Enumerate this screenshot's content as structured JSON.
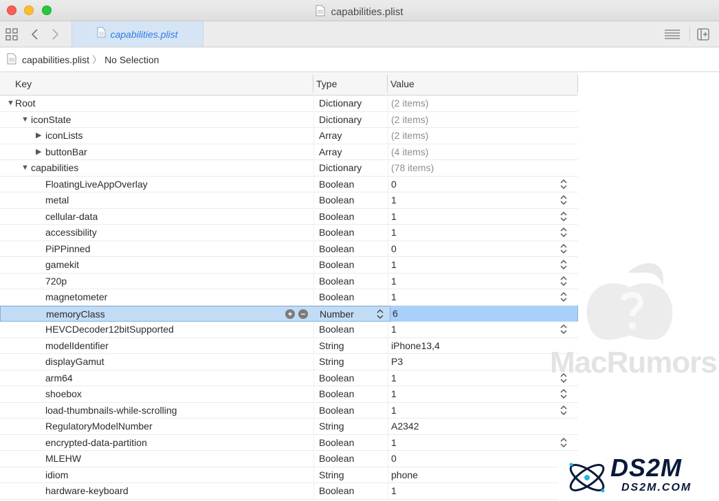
{
  "window": {
    "title": "capabilities.plist",
    "controls": [
      "close",
      "minimize",
      "zoom"
    ]
  },
  "toolbar": {
    "tab_label": "capabilities.plist",
    "icons": [
      "grid-icon",
      "back-chevron-icon",
      "forward-chevron-icon",
      "editor-options-icon",
      "add-editor-icon"
    ]
  },
  "jumpbar": {
    "file": "capabilities.plist",
    "selection": "No Selection"
  },
  "table": {
    "headers": {
      "key": "Key",
      "type": "Type",
      "value": "Value"
    },
    "rows": [
      {
        "key": "Root",
        "type": "Dictionary",
        "value": "(2 items)",
        "level": 0,
        "disclosure": "open",
        "muted": true,
        "stepper": false
      },
      {
        "key": "iconState",
        "type": "Dictionary",
        "value": "(2 items)",
        "level": 1,
        "disclosure": "open",
        "muted": true,
        "stepper": false
      },
      {
        "key": "iconLists",
        "type": "Array",
        "value": "(2 items)",
        "level": 2,
        "disclosure": "closed",
        "muted": true,
        "stepper": false
      },
      {
        "key": "buttonBar",
        "type": "Array",
        "value": "(4 items)",
        "level": 2,
        "disclosure": "closed",
        "muted": true,
        "stepper": false
      },
      {
        "key": "capabilities",
        "type": "Dictionary",
        "value": "(78 items)",
        "level": 1,
        "disclosure": "open",
        "muted": true,
        "stepper": false
      },
      {
        "key": "FloatingLiveAppOverlay",
        "type": "Boolean",
        "value": "0",
        "level": 2,
        "stepper": true
      },
      {
        "key": "metal",
        "type": "Boolean",
        "value": "1",
        "level": 2,
        "stepper": true
      },
      {
        "key": "cellular-data",
        "type": "Boolean",
        "value": "1",
        "level": 2,
        "stepper": true
      },
      {
        "key": "accessibility",
        "type": "Boolean",
        "value": "1",
        "level": 2,
        "stepper": true
      },
      {
        "key": "PiPPinned",
        "type": "Boolean",
        "value": "0",
        "level": 2,
        "stepper": true
      },
      {
        "key": "gamekit",
        "type": "Boolean",
        "value": "1",
        "level": 2,
        "stepper": true
      },
      {
        "key": "720p",
        "type": "Boolean",
        "value": "1",
        "level": 2,
        "stepper": true
      },
      {
        "key": "magnetometer",
        "type": "Boolean",
        "value": "1",
        "level": 2,
        "stepper": true
      },
      {
        "key": "memoryClass",
        "type": "Number",
        "value": "6",
        "level": 2,
        "selected": true,
        "stepper": false
      },
      {
        "key": "HEVCDecoder12bitSupported",
        "type": "Boolean",
        "value": "1",
        "level": 2,
        "stepper": true
      },
      {
        "key": "modelIdentifier",
        "type": "String",
        "value": "iPhone13,4",
        "level": 2,
        "stepper": false
      },
      {
        "key": "displayGamut",
        "type": "String",
        "value": "P3",
        "level": 2,
        "stepper": false
      },
      {
        "key": "arm64",
        "type": "Boolean",
        "value": "1",
        "level": 2,
        "stepper": true
      },
      {
        "key": "shoebox",
        "type": "Boolean",
        "value": "1",
        "level": 2,
        "stepper": true
      },
      {
        "key": "load-thumbnails-while-scrolling",
        "type": "Boolean",
        "value": "1",
        "level": 2,
        "stepper": true
      },
      {
        "key": "RegulatoryModelNumber",
        "type": "String",
        "value": "A2342",
        "level": 2,
        "stepper": false
      },
      {
        "key": "encrypted-data-partition",
        "type": "Boolean",
        "value": "1",
        "level": 2,
        "stepper": true
      },
      {
        "key": "MLEHW",
        "type": "Boolean",
        "value": "0",
        "level": 2,
        "stepper": false
      },
      {
        "key": "idiom",
        "type": "String",
        "value": "phone",
        "level": 2,
        "stepper": false
      },
      {
        "key": "hardware-keyboard",
        "type": "Boolean",
        "value": "1",
        "level": 2,
        "stepper": false
      }
    ]
  },
  "watermarks": {
    "macrumors": "MacRumors",
    "ds2m_name": "DS2M",
    "ds2m_url": "DS2M.COM"
  }
}
